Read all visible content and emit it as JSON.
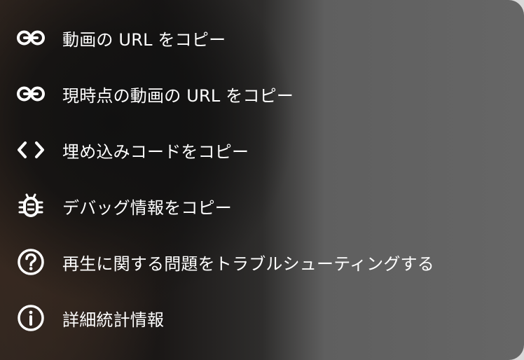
{
  "context_menu": {
    "items": [
      {
        "label": "動画の URL をコピー",
        "icon": "link-icon"
      },
      {
        "label": "現時点の動画の URL をコピー",
        "icon": "link-icon"
      },
      {
        "label": "埋め込みコードをコピー",
        "icon": "code-icon"
      },
      {
        "label": "デバッグ情報をコピー",
        "icon": "bug-icon"
      },
      {
        "label": "再生に関する問題をトラブルシューティングする",
        "icon": "help-circle-icon"
      },
      {
        "label": "詳細統計情報",
        "icon": "info-circle-icon"
      }
    ]
  },
  "colors": {
    "text": "#ffffff",
    "panel_gray": "#666666"
  }
}
